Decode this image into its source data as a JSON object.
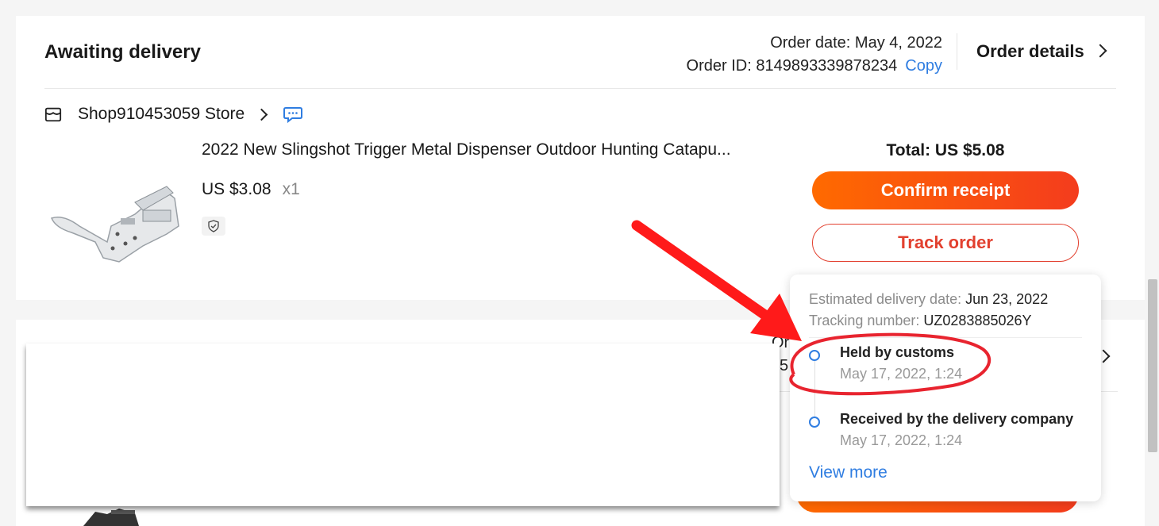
{
  "order": {
    "status": "Awaiting delivery",
    "date_label": "Order date: May 4, 2022",
    "id_label": "Order ID: 8149893339878234",
    "copy_label": "Copy",
    "details_label": "Order details"
  },
  "store": {
    "name": "Shop910453059 Store"
  },
  "product": {
    "name": "2022 New Slingshot Trigger Metal Dispenser Outdoor Hunting Catapu...",
    "price": "US $3.08",
    "quantity": "x1"
  },
  "actions": {
    "total": "Total: US $5.08",
    "confirm_label": "Confirm receipt",
    "track_label": "Track order"
  },
  "tracking": {
    "est_label": "Estimated delivery date:",
    "est_value": "Jun 23, 2022",
    "num_label": "Tracking number:",
    "num_value": "UZ0283885026Y",
    "events": [
      {
        "title": "Held by customs",
        "time": "May 17, 2022, 1:24"
      },
      {
        "title": "Received by the delivery company",
        "time": "May 17, 2022, 1:24"
      }
    ],
    "view_more": "View more"
  },
  "second_card": {
    "partial_order": "Or",
    "partial_id": "5"
  },
  "annotation": {
    "arrow_color": "#ff1a1a",
    "circle_color": "#e8242f"
  },
  "icons": {
    "store": "store-icon",
    "chat": "chat-bubble-icon",
    "shield": "shield-check-icon",
    "chevron": "chevron-right-icon"
  }
}
